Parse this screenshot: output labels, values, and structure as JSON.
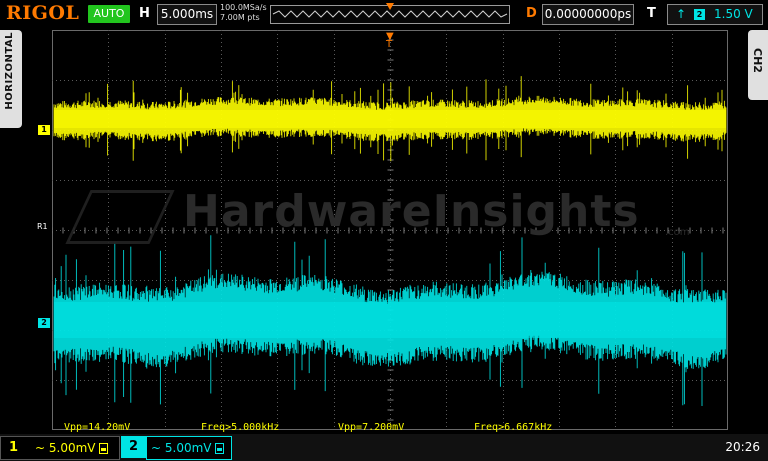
{
  "top": {
    "brand": "RIGOL",
    "run_status": "AUTO",
    "horizontal_label": "H",
    "timebase": "5.000ms",
    "sample_rate": "100.0MSa/s",
    "memory_depth": "7.00M pts",
    "delay_label": "D",
    "delay": "0.00000000ps",
    "trigger_label": "T",
    "trigger_source": "2",
    "trigger_level": "1.50 V"
  },
  "side": {
    "left_tab": "HORIZONTAL",
    "right_tab": "CH2"
  },
  "markers": {
    "ch1": "1",
    "ch2": "2",
    "ref": "R1"
  },
  "watermark": {
    "text": "HardwareInsights",
    "sub": ".com"
  },
  "measurements": [
    {
      "label": "Vpp=14.20mV",
      "color": "#ffff00"
    },
    {
      "label": "Freq>5.000kHz",
      "color": "#ffff00"
    },
    {
      "label": "Vpp=7.200mV",
      "color": "#ffff00"
    },
    {
      "label": "Freq>6.667kHz",
      "color": "#ffff00"
    }
  ],
  "bottom": {
    "ch1_num": "1",
    "ch1_scale": "~ 5.00mV",
    "ch2_num": "2",
    "ch2_scale": "~ 5.00mV",
    "clock": "20:26"
  },
  "colors": {
    "ch1": "#ffff00",
    "ch2": "#00e5e5",
    "accent": "#ff7a00",
    "status_green": "#22c51e"
  }
}
